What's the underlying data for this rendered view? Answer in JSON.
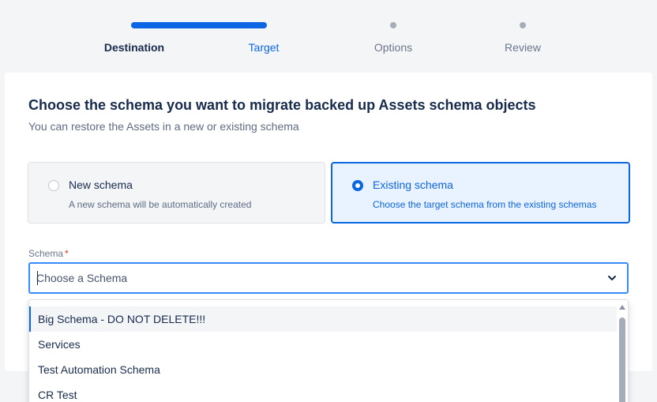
{
  "stepper": {
    "steps": [
      {
        "label": "Destination",
        "state": "done"
      },
      {
        "label": "Target",
        "state": "current"
      },
      {
        "label": "Options",
        "state": "todo"
      },
      {
        "label": "Review",
        "state": "todo"
      }
    ]
  },
  "main": {
    "heading": "Choose the schema you want to migrate backed up Assets schema objects",
    "subheading": "You can restore the Assets in a new or existing schema",
    "options": [
      {
        "title": "New schema",
        "description": "A new schema will be automatically created",
        "selected": false
      },
      {
        "title": "Existing schema",
        "description": "Choose the target schema from the existing schemas",
        "selected": true
      }
    ],
    "schema_field": {
      "label": "Schema",
      "required_marker": "*",
      "placeholder": "Choose a Schema",
      "value": ""
    },
    "dropdown": {
      "items": [
        "Big Schema - DO NOT DELETE!!!",
        "Services",
        "Test Automation Schema",
        "CR Test"
      ],
      "highlighted_index": 0
    }
  },
  "colors": {
    "accent": "#0c66e4",
    "focus_border": "#388bff",
    "required": "#de350b",
    "selected_bg": "#e9f2ff"
  },
  "icons": {
    "select_chevron": "chevron-down-icon",
    "scroll_up": "scroll-up-arrow-icon"
  }
}
